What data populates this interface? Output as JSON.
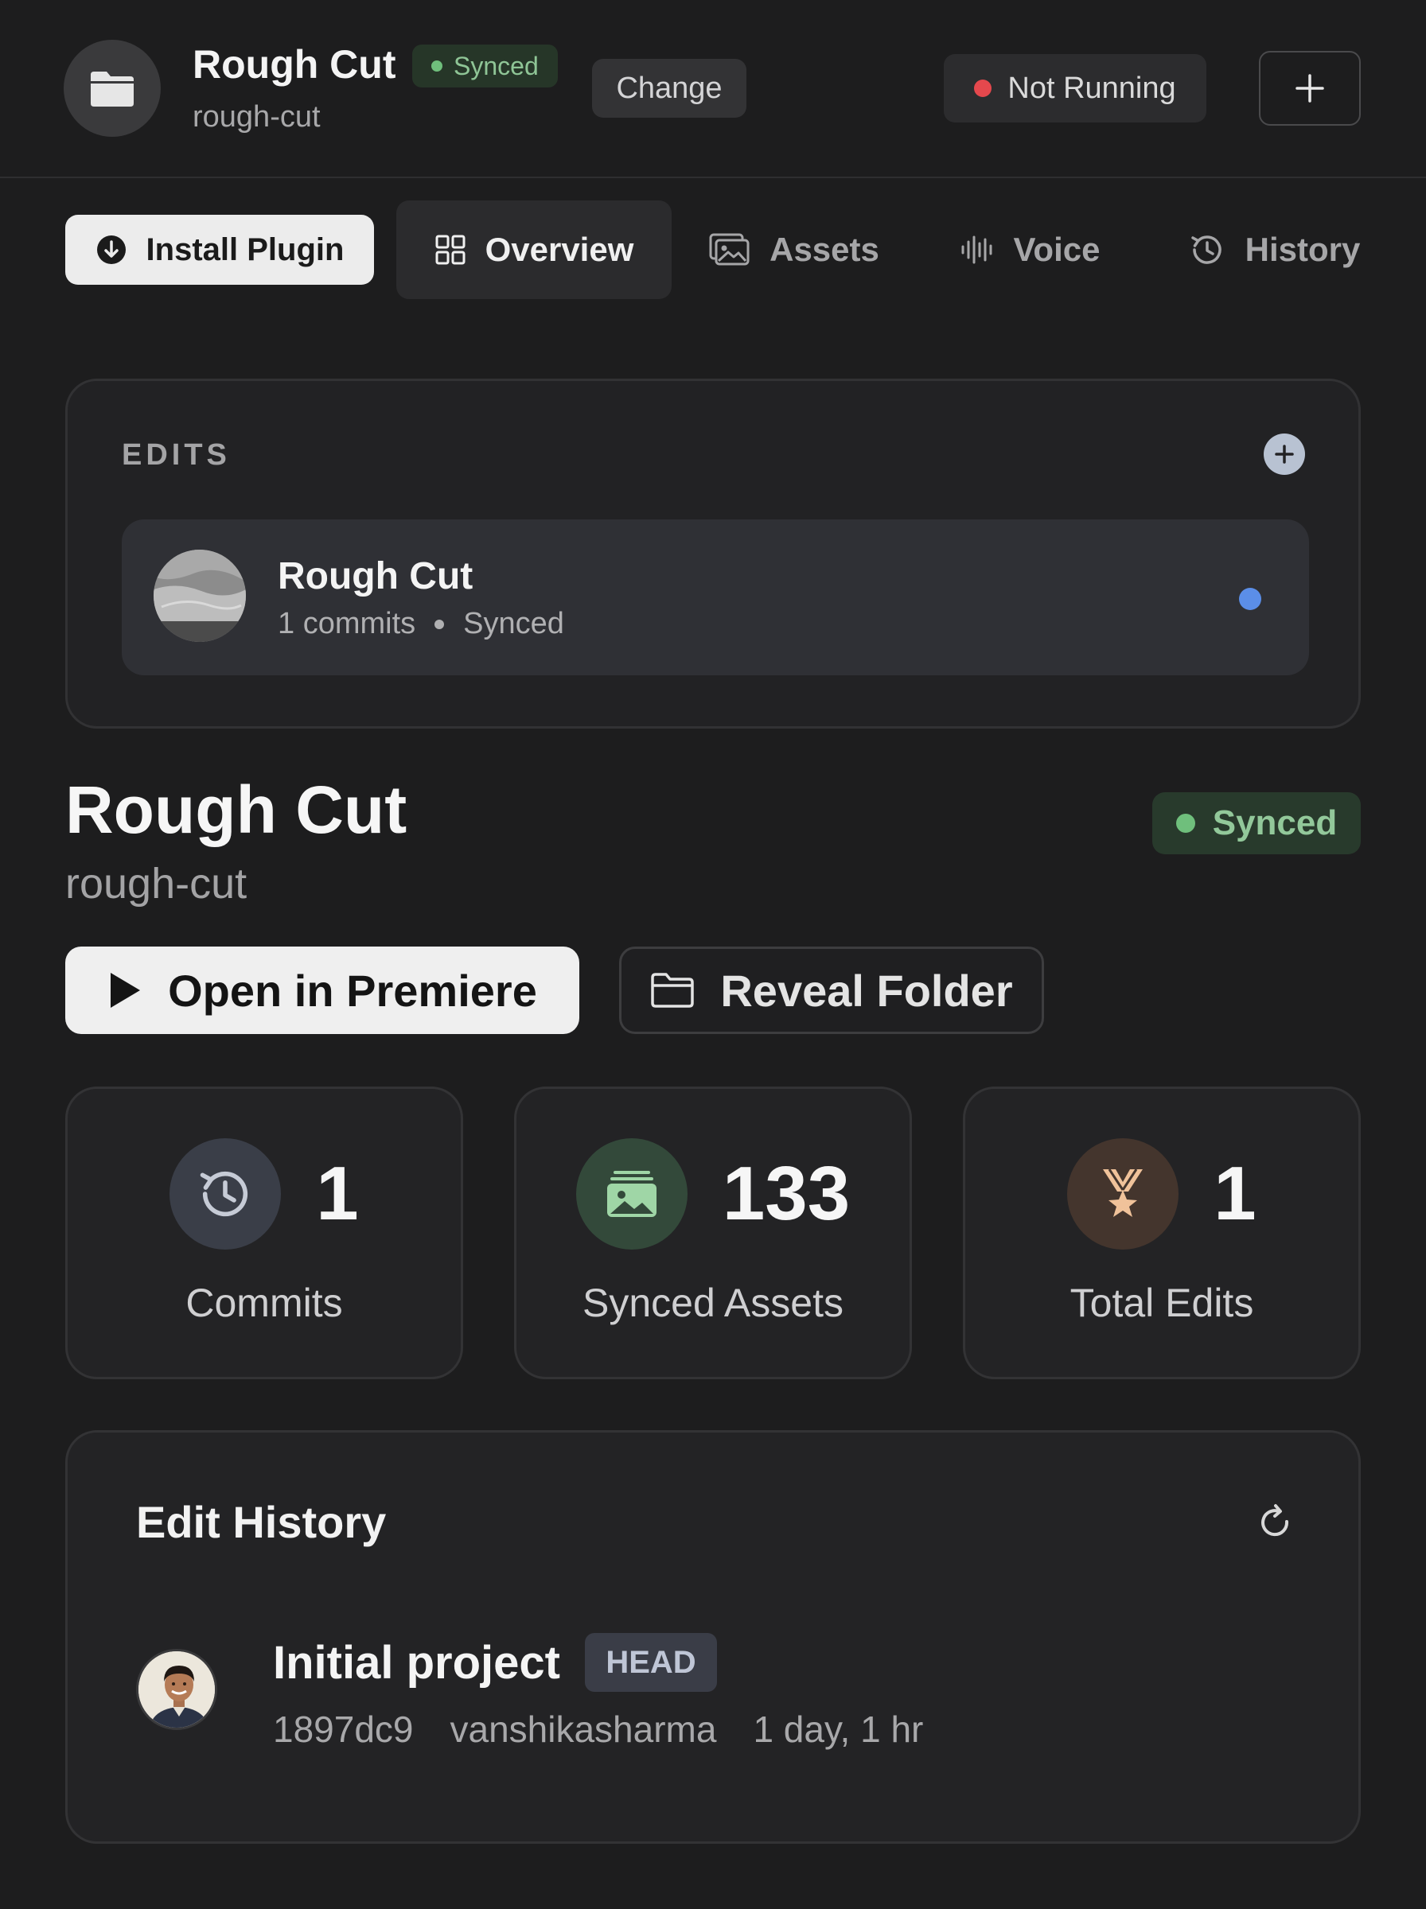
{
  "header": {
    "project_name": "Rough Cut",
    "project_slug": "rough-cut",
    "sync_status": "Synced",
    "change_label": "Change",
    "run_status": "Not Running",
    "colors": {
      "synced": "#6fbf7c",
      "not_running": "#e5484d"
    }
  },
  "toolbar": {
    "install_label": "Install Plugin",
    "tabs": [
      {
        "label": "Overview",
        "icon": "grid-icon",
        "active": true
      },
      {
        "label": "Assets",
        "icon": "images-icon",
        "active": false
      },
      {
        "label": "Voice",
        "icon": "waveform-icon",
        "active": false
      },
      {
        "label": "History",
        "icon": "clock-history-icon",
        "active": false
      }
    ]
  },
  "edits": {
    "section_label": "EDITS",
    "items": [
      {
        "name": "Rough Cut",
        "commits": "1 commits",
        "status": "Synced",
        "indicator_color": "#5b8ee8"
      }
    ]
  },
  "detail": {
    "title": "Rough Cut",
    "slug": "rough-cut",
    "status": "Synced",
    "open_label": "Open in Premiere",
    "reveal_label": "Reveal Folder"
  },
  "stats": [
    {
      "value": "1",
      "label": "Commits",
      "icon": "history-icon"
    },
    {
      "value": "133",
      "label": "Synced Assets",
      "icon": "images-icon"
    },
    {
      "value": "1",
      "label": "Total Edits",
      "icon": "medal-icon"
    }
  ],
  "history": {
    "title": "Edit History",
    "commits": [
      {
        "message": "Initial project",
        "badge": "HEAD",
        "hash": "1897dc9",
        "author": "vanshikasharma",
        "age": "1 day, 1 hr"
      }
    ]
  }
}
